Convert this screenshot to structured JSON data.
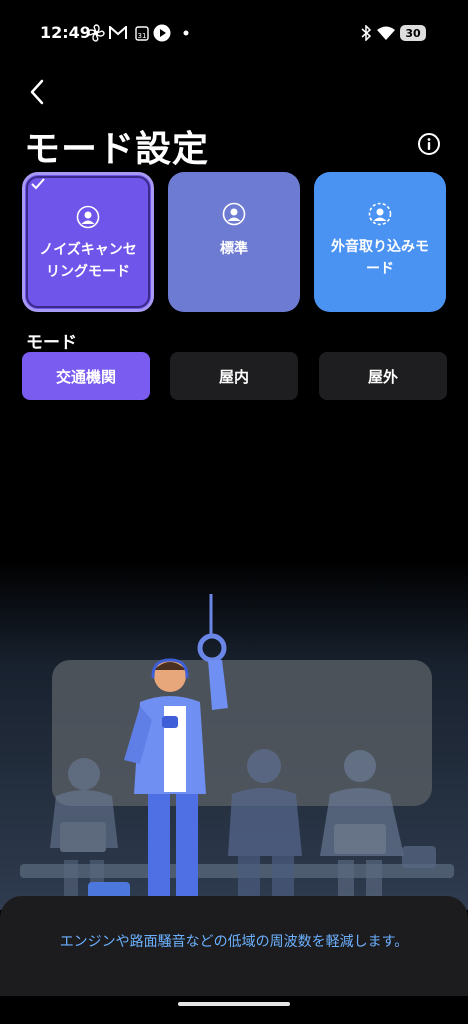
{
  "status_bar": {
    "time": "12:49",
    "battery": "30",
    "icons": [
      "pinwheel-icon",
      "gmail-icon",
      "calendar-icon",
      "play-icon",
      "dot-icon",
      "bluetooth-icon",
      "wifi-icon",
      "battery-icon"
    ]
  },
  "header": {
    "title": "モード設定"
  },
  "modes": [
    {
      "label": "ノイズキャンセリングモード",
      "selected": true
    },
    {
      "label": "標準",
      "selected": false
    },
    {
      "label": "外音取り込みモード",
      "selected": false
    }
  ],
  "sub_mode": {
    "section_label": "モード",
    "options": [
      "交通機関",
      "屋内",
      "屋外"
    ],
    "selected": "交通機関"
  },
  "description": "エンジンや路面騒音などの低域の周波数を軽減します。",
  "colors": {
    "accent": "#7a5cf0",
    "noise_cancel_card": "#6f55e9",
    "standard_card": "#6e7bd3",
    "ambient_card": "#4b93f3",
    "description_text": "#6cb1ff"
  }
}
